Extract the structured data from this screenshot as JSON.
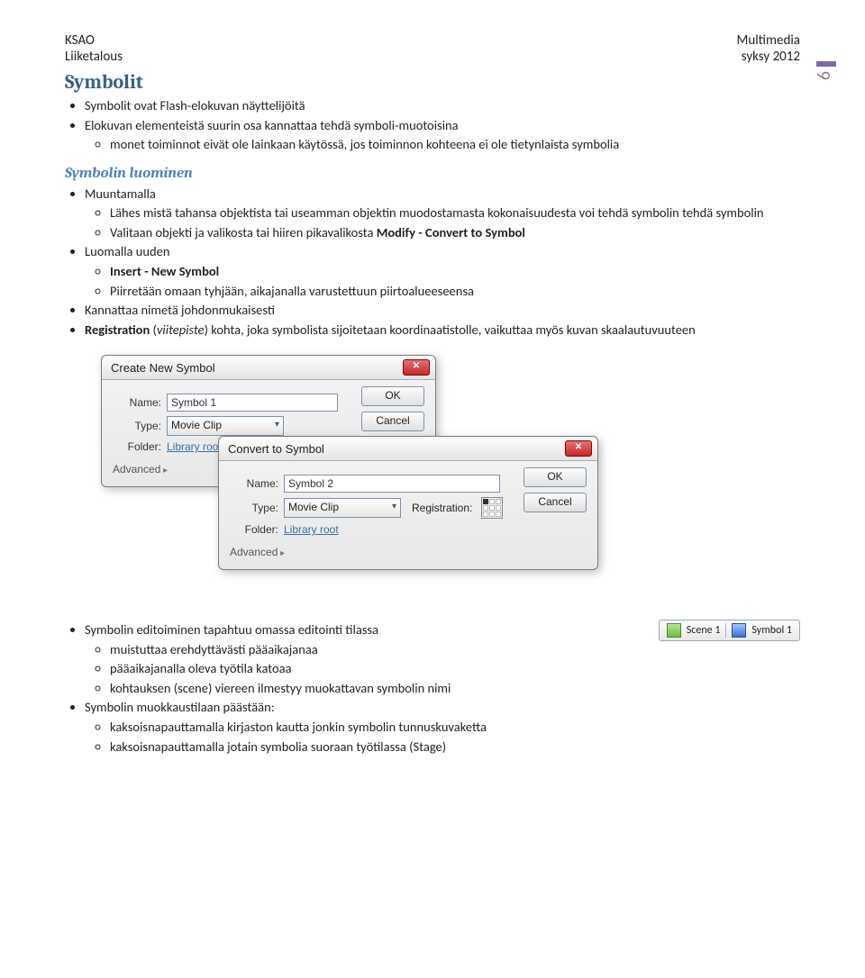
{
  "header": {
    "left1": "KSAO",
    "left2": "Liiketalous",
    "right1": "Multimedia",
    "right2": "syksy 2012",
    "page_number": "6"
  },
  "section": {
    "title": "Symbolit",
    "items": [
      "Symbolit ovat Flash-elokuvan näyttelijöitä",
      "Elokuvan elementeistä suurin osa kannattaa tehdä symboli-muotoisina"
    ],
    "sub_items": [
      "monet toiminnot eivät ole lainkaan käytössä, jos toiminnon kohteena ei ole tietynlaista symbolia"
    ]
  },
  "create": {
    "title": "Symbolin luominen",
    "muuntamalla": "Muuntamalla",
    "muu_items": [
      "Lähes mistä tahansa objektista tai useamman  objektin muodostamasta kokonaisuudesta voi tehdä symbolin tehdä symbolin",
      "Valitaan objekti ja valikosta tai hiiren pikavalikosta "
    ],
    "muu_bold": "Modify - Convert to Symbol",
    "luomalla": "Luomalla uuden",
    "luo_items": [
      "Insert - New Symbol",
      "Piirretään omaan tyhjään, aikajanalla varustettuun piirtoalueeseensa"
    ],
    "kanna": "Kannattaa nimetä johdonmukaisesti",
    "reg_pre": "Registration",
    "reg_pre2": " (",
    "viitepiste": "viitepiste",
    "reg_post": ") kohta, joka symbolista sijoitetaan koordinaatistolle, vaikuttaa myös kuvan skaalautuvuuteen"
  },
  "dialog1": {
    "title": "Create New Symbol",
    "name_label": "Name:",
    "name_value": "Symbol 1",
    "type_label": "Type:",
    "type_value": "Movie Clip",
    "folder_label": "Folder:",
    "folder_value": "Library root",
    "advanced": "Advanced",
    "ok": "OK",
    "cancel": "Cancel"
  },
  "dialog2": {
    "title": "Convert to Symbol",
    "name_label": "Name:",
    "name_value": "Symbol 2",
    "type_label": "Type:",
    "type_value": "Movie Clip",
    "registration": "Registration:",
    "folder_label": "Folder:",
    "folder_value": "Library root",
    "advanced": "Advanced",
    "ok": "OK",
    "cancel": "Cancel"
  },
  "edit": {
    "l1": "Symbolin editoiminen tapahtuu omassa editointi tilassa",
    "items": [
      "muistuttaa erehdyttävästi pääaikajanaa",
      "pääaikajanalla oleva työtila katoaa",
      "kohtauksen (scene) viereen ilmestyy muokattavan symbolin nimi"
    ],
    "l2": "Symbolin muokkaustilaan päästään:",
    "items2": [
      "kaksoisnapauttamalla kirjaston kautta jonkin symbolin tunnuskuvaketta",
      "kaksoisnapauttamalla jotain symbolia suoraan työtilassa (Stage)"
    ]
  },
  "crumb": {
    "scene": "Scene 1",
    "sym": "Symbol 1"
  }
}
